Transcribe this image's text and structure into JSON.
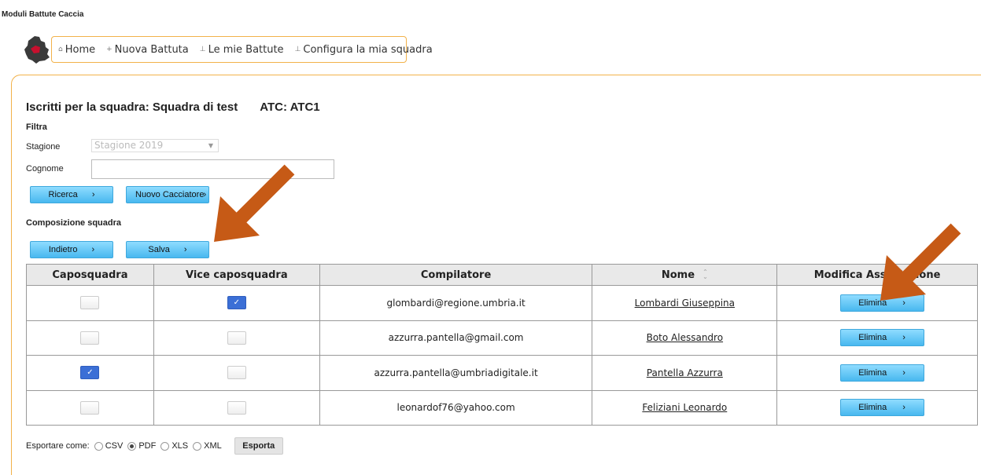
{
  "app": {
    "title": "Moduli Battute Caccia"
  },
  "nav": {
    "items": [
      {
        "icon": "home-icon",
        "label": "Home"
      },
      {
        "icon": "plus-icon",
        "label": "Nuova Battuta"
      },
      {
        "icon": "pin-icon",
        "label": "Le mie Battute"
      },
      {
        "icon": "pin-icon",
        "label": "Configura la mia squadra"
      }
    ]
  },
  "header": {
    "title": "Iscritti per la squadra: Squadra di test",
    "atc": "ATC: ATC1"
  },
  "filter": {
    "section_label": "Filtra",
    "season_label": "Stagione",
    "season_value": "Stagione 2019",
    "surname_label": "Cognome",
    "surname_value": "",
    "search_button": "Ricerca",
    "new_hunter_button": "Nuovo Cacciatore"
  },
  "composition": {
    "section_label": "Composizione squadra",
    "back_button": "Indietro",
    "save_button": "Salva"
  },
  "table": {
    "headers": [
      "Caposquadra",
      "Vice caposquadra",
      "Compilatore",
      "Nome",
      "Modifica Associazione"
    ],
    "rows": [
      {
        "caposquadra": false,
        "vice": true,
        "compilatore": "glombardi@regione.umbria.it",
        "nome": "Lombardi Giuseppina",
        "action": "Elimina"
      },
      {
        "caposquadra": false,
        "vice": false,
        "compilatore": "azzurra.pantella@gmail.com",
        "nome": "Boto Alessandro",
        "action": "Elimina"
      },
      {
        "caposquadra": true,
        "vice": false,
        "compilatore": "azzurra.pantella@umbriadigitale.it",
        "nome": "Pantella Azzurra",
        "action": "Elimina"
      },
      {
        "caposquadra": false,
        "vice": false,
        "compilatore": "leonardof76@yahoo.com",
        "nome": "Feliziani Leonardo",
        "action": "Elimina"
      }
    ]
  },
  "export": {
    "label": "Esportare come:",
    "options": [
      "CSV",
      "PDF",
      "XLS",
      "XML"
    ],
    "selected": "PDF",
    "button": "Esporta"
  },
  "colors": {
    "accent_border": "#f2b24a",
    "button_blue": "#48b8ef",
    "arrow": "#c65a16",
    "checkbox_on": "#3b6fd6"
  }
}
